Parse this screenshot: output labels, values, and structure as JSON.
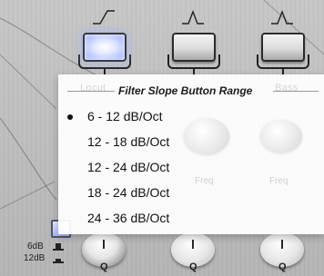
{
  "background": {
    "brand_color": "#c1c1c1",
    "button_lit_color": "#a9b8ff"
  },
  "slope_icons": [
    {
      "name": "low-shelf-icon"
    },
    {
      "name": "peak-icon"
    },
    {
      "name": "peak-icon"
    }
  ],
  "dropdown": {
    "title": "Filter Slope Button Range",
    "ghost_labels": [
      "Locut",
      "Bass"
    ],
    "background_labels": [
      "Freq",
      "Freq"
    ],
    "options": [
      {
        "label": "6 - 12 dB/Oct",
        "selected": true
      },
      {
        "label": "12 - 18 dB/Oct",
        "selected": false
      },
      {
        "label": "12 - 24 dB/Oct",
        "selected": false
      },
      {
        "label": "18 - 24 dB/Oct",
        "selected": false
      },
      {
        "label": "24 - 36 dB/Oct",
        "selected": false
      }
    ]
  },
  "bottom": {
    "q_labels": [
      "Q",
      "Q",
      "Q"
    ],
    "db_labels": [
      "6dB",
      "12dB"
    ]
  }
}
